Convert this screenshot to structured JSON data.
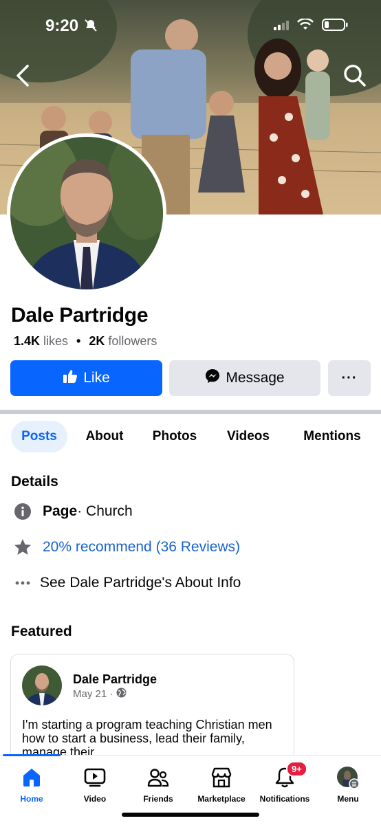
{
  "status": {
    "time": "9:20"
  },
  "profile": {
    "name": "Dale Partridge",
    "likes_count": "1.4K",
    "likes_word": "likes",
    "followers_count": "2K",
    "followers_word": "followers"
  },
  "actions": {
    "like": "Like",
    "message": "Message",
    "more": "···"
  },
  "tabs": [
    "Posts",
    "About",
    "Photos",
    "Videos",
    "Mentions"
  ],
  "details": {
    "title": "Details",
    "category_label": "Page",
    "category_value": " · Church",
    "recommend": "20% recommend (36 Reviews)",
    "about_link": "See Dale Partridge's About Info"
  },
  "featured": {
    "title": "Featured",
    "author": "Dale Partridge",
    "date": "May 21 ·",
    "text": "I'm starting a program teaching Christian men how to start a business, lead their family, manage their"
  },
  "nav": {
    "items": [
      {
        "label": "Home",
        "icon": "home-icon"
      },
      {
        "label": "Video",
        "icon": "video-icon"
      },
      {
        "label": "Friends",
        "icon": "friends-icon"
      },
      {
        "label": "Marketplace",
        "icon": "marketplace-icon"
      },
      {
        "label": "Notifications",
        "icon": "bell-icon"
      },
      {
        "label": "Menu",
        "icon": "menu-avatar-icon"
      }
    ],
    "notifications_badge": "9+"
  },
  "colors": {
    "accent": "#0866ff",
    "link": "#1763cf",
    "badge": "#e41e3f"
  }
}
